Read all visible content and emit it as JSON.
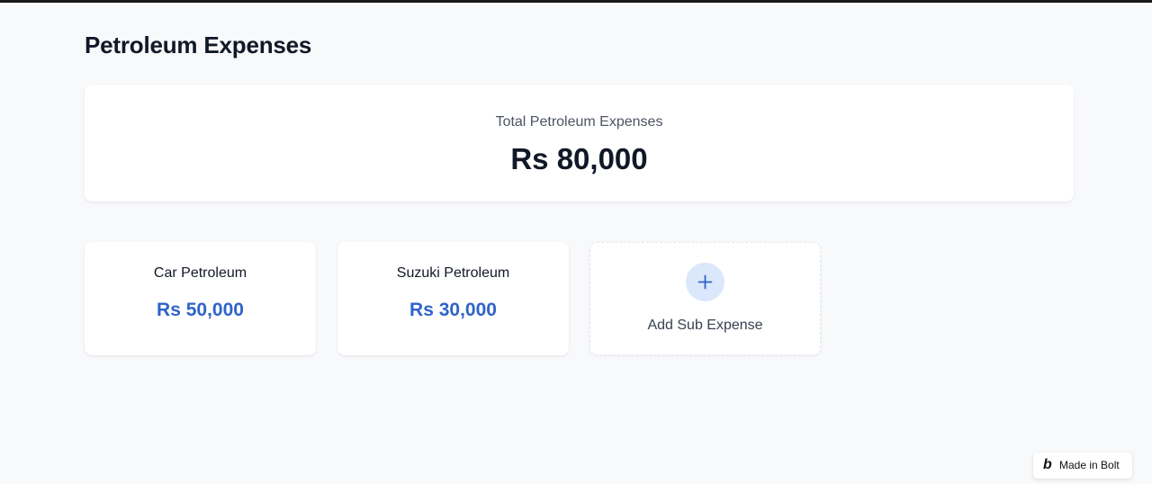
{
  "page": {
    "title": "Petroleum Expenses"
  },
  "summary": {
    "label": "Total Petroleum Expenses",
    "value": "Rs 80,000"
  },
  "sub_expenses": [
    {
      "name": "Car Petroleum",
      "amount": "Rs 50,000"
    },
    {
      "name": "Suzuki Petroleum",
      "amount": "Rs 30,000"
    }
  ],
  "add_card": {
    "label": "Add Sub Expense",
    "icon": "plus-icon"
  },
  "badge": {
    "logo": "b",
    "label": "Made in Bolt",
    "icon": "bolt-logo-icon"
  },
  "colors": {
    "amount_accent": "#2f63c9",
    "add_icon_bg": "#dbe7fb",
    "page_bg": "#f8f9fb"
  }
}
